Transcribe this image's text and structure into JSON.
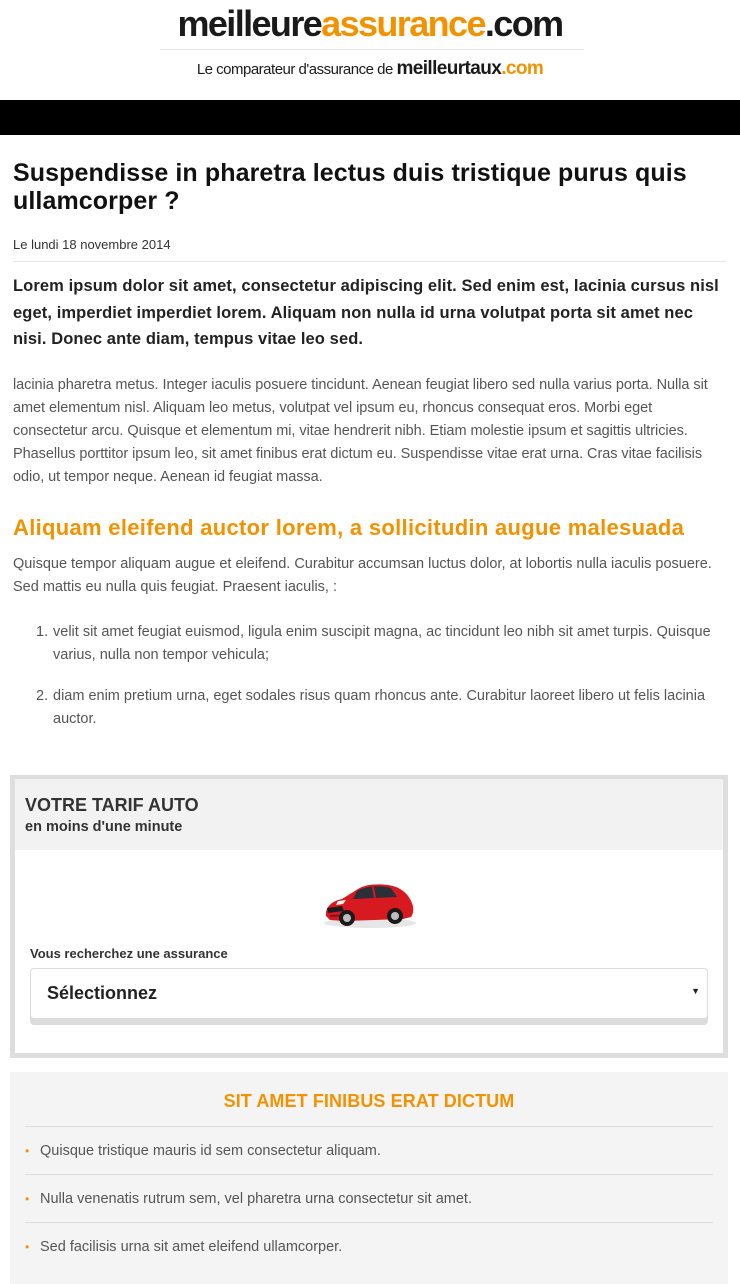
{
  "header": {
    "logo": {
      "part1": "meilleure",
      "part2": "assurance",
      "part3": ".com"
    },
    "tagline": {
      "text": "Le comparateur d'assurance de ",
      "brand1": "meilleurtaux",
      "brand2": ".com"
    }
  },
  "article": {
    "title": "Suspendisse in pharetra lectus duis tristique purus quis ullamcorper ?",
    "date": "Le lundi 18 novembre 2014",
    "lead": "Lorem ipsum dolor sit amet, consectetur adipiscing elit. Sed enim est, lacinia cursus nisl eget, imperdiet imperdiet lorem. Aliquam non nulla id urna volutpat porta sit amet nec nisi. Donec ante diam, tempus vitae leo sed.",
    "paragraph1": "lacinia pharetra metus. Integer iaculis posuere tincidunt. Aenean feugiat libero sed nulla varius porta. Nulla sit amet elementum nisl. Aliquam leo metus, volutpat vel ipsum eu, rhoncus consequat eros. Morbi eget consectetur arcu. Quisque et elementum mi, vitae hendrerit nibh. Etiam molestie ipsum et sagittis ultricies. Phasellus porttitor ipsum leo, sit amet finibus erat dictum eu. Suspendisse vitae erat urna. Cras vitae facilisis odio, ut tempor neque. Aenean id feugiat massa.",
    "subtitle": "Aliquam eleifend auctor lorem, a sollicitudin augue malesuada",
    "paragraph2": "Quisque tempor aliquam augue et eleifend. Curabitur accumsan luctus dolor, at lobortis nulla iaculis posuere. Sed mattis eu nulla quis feugiat. Praesent iaculis, :",
    "list": [
      {
        "num": "1.",
        "text": "velit sit amet feugiat euismod, ligula enim suscipit magna, ac tincidunt leo nibh sit amet turpis. Quisque varius, nulla non tempor vehicula;"
      },
      {
        "num": "2.",
        "text": "diam enim pretium urna, eget sodales risus quam rhoncus ante. Curabitur laoreet libero ut felis lacinia auctor."
      }
    ]
  },
  "tarif": {
    "title": "VOTRE TARIF AUTO",
    "subtitle": "en moins d'une minute",
    "field_label": "Vous recherchez une assurance",
    "select_value": "Sélectionnez",
    "select_arrow": "▼"
  },
  "sidebar_box": {
    "title": "SIT AMET FINIBUS ERAT DICTUM",
    "bullet": "•",
    "items": [
      "Quisque tristique mauris id sem consectetur aliquam.",
      "Nulla venenatis rutrum sem, vel pharetra urna consectetur sit amet.",
      "Sed facilisis urna sit amet eleifend ullamcorper."
    ]
  },
  "colors": {
    "accent": "#f39200",
    "text": "#333333",
    "bar": "#000000"
  }
}
